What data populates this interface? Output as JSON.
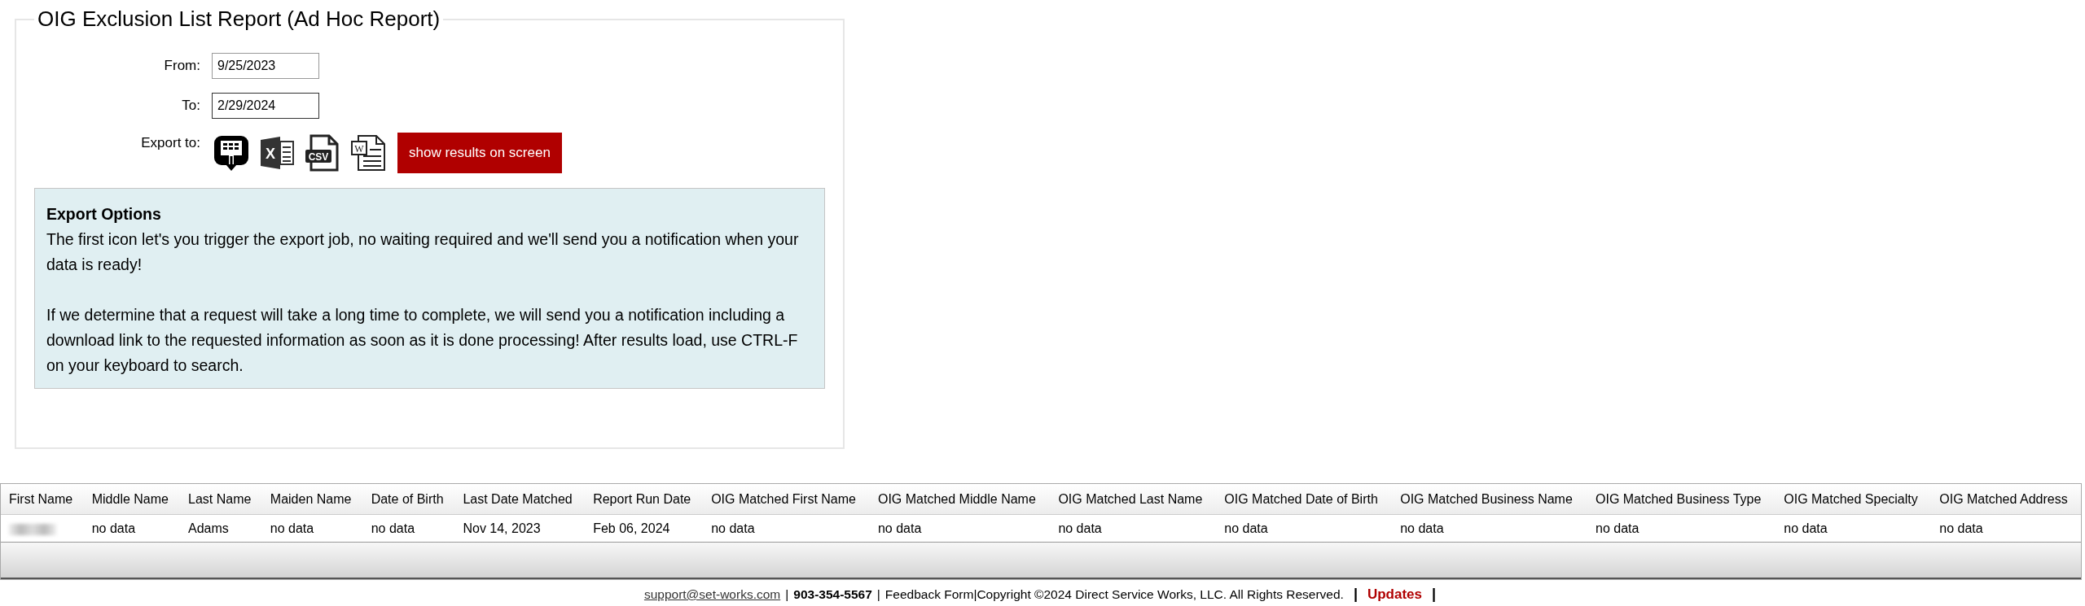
{
  "title": "OIG Exclusion List Report (Ad Hoc Report)",
  "fields": [
    {
      "label": "From:",
      "value": "9/25/2023"
    },
    {
      "label": "To:",
      "value": "2/29/2024"
    }
  ],
  "export": {
    "label": "Export to:",
    "icons": [
      {
        "kind": "job"
      },
      {
        "kind": "excel",
        "glyph": "X"
      },
      {
        "kind": "csv",
        "glyph": "CSV"
      },
      {
        "kind": "word",
        "glyph": "W"
      }
    ],
    "button": "show results on screen"
  },
  "info": {
    "heading": "Export Options",
    "paragraphs": [
      "The first icon let's you trigger the export job, no waiting required and we'll send you a notification when your data is ready!",
      "If we determine that a request will take a long time to complete, we will send you a notification including a download link to the requested information as soon as it is done processing! After results load, use CTRL-F on your keyboard to search."
    ]
  },
  "table": {
    "columns": [
      "First Name",
      "Middle Name",
      "Last Name",
      "Maiden Name",
      "Date of Birth",
      "Last Date Matched",
      "Report Run Date",
      "OIG Matched First Name",
      "OIG Matched Middle Name",
      "OIG Matched Last Name",
      "OIG Matched Date of Birth",
      "OIG Matched Business Name",
      "OIG Matched Business Type",
      "OIG Matched Specialty",
      "OIG Matched Address"
    ],
    "rows": [
      {
        "first_name_redacted": true,
        "cells": [
          "",
          "no data",
          "Adams",
          "no data",
          "no data",
          "Nov 14, 2023",
          "Feb 06, 2024",
          "no data",
          "no data",
          "no data",
          "no data",
          "no data",
          "no data",
          "no data",
          "no data"
        ]
      }
    ]
  },
  "footer": [
    {
      "kind": "link",
      "text": "support@set-works.com"
    },
    {
      "kind": "sep",
      "text": "|"
    },
    {
      "kind": "bold",
      "text": "903-354-5567"
    },
    {
      "kind": "sep",
      "text": "|"
    },
    {
      "kind": "plainlink",
      "text": "Feedback Form"
    },
    {
      "kind": "text",
      "text": "|Copyright ©2024 Direct Service Works, LLC. All Rights Reserved."
    },
    {
      "kind": "boldsep",
      "text": "|"
    },
    {
      "kind": "updates",
      "text": "Updates"
    },
    {
      "kind": "boldsep",
      "text": "|"
    }
  ]
}
